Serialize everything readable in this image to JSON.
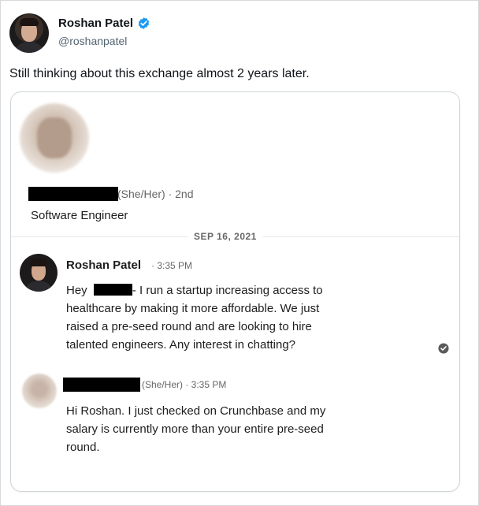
{
  "tweet": {
    "author_name": "Roshan Patel",
    "handle": "@roshanpatel",
    "text": "Still thinking about this exchange almost 2 years later.",
    "verified_color": "#1d9bf0"
  },
  "card": {
    "profile": {
      "pronoun_degree": "(She/Her) · 2nd",
      "title": "Software Engineer"
    },
    "date_separator": "SEP 16, 2021",
    "message1": {
      "sender": "Roshan Patel",
      "time": "· 3:35 PM",
      "greeting": "Hey",
      "lines": [
        "- I run a startup increasing access to",
        "healthcare by making it more affordable. We just",
        "raised a pre-seed round and are looking to hire",
        "talented engineers. Any interest in chatting?"
      ]
    },
    "message2": {
      "meta": "(She/Her) · 3:35 PM",
      "lines": [
        "Hi Roshan. I just checked on Crunchbase and my",
        "salary is currently more than your entire pre-seed",
        "round."
      ]
    }
  }
}
